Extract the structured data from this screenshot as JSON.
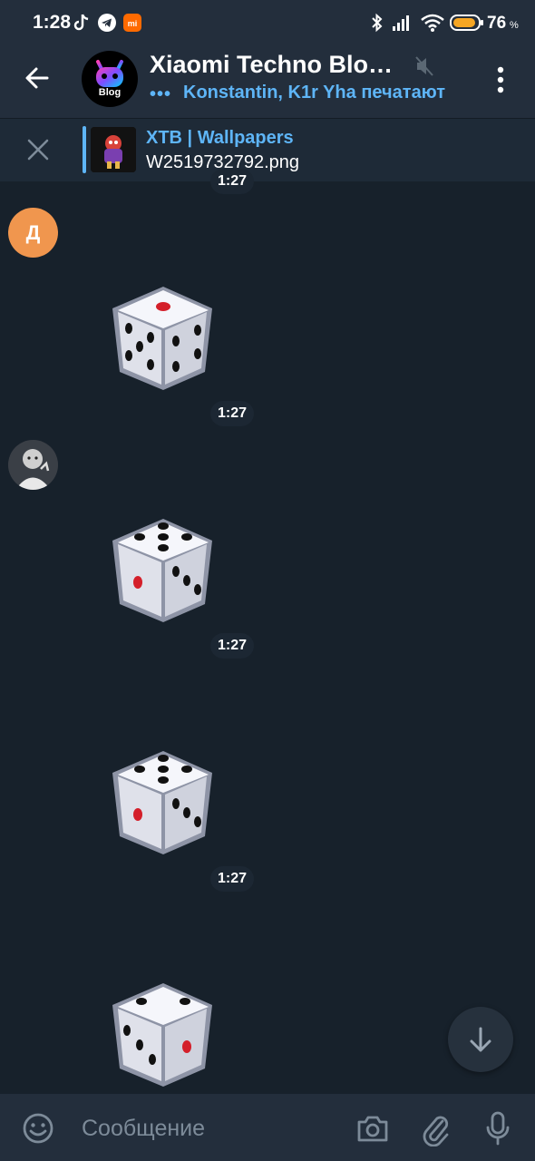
{
  "status_bar": {
    "time": "1:28",
    "battery_level": "76",
    "battery_pct_sign": "%"
  },
  "header": {
    "title": "Xiaomi Techno Blo…",
    "avatar_text": "Blog",
    "typing_dots": "•••",
    "status": "Konstantin, K1r Yha печатают"
  },
  "pinned": {
    "title": "XTB | Wallpapers",
    "text": "W2519732792.png"
  },
  "messages": [
    {
      "time": "1:27"
    },
    {
      "sender_initial": "Д",
      "dice_value": 1,
      "time": "1:27"
    },
    {
      "dice_value": 5,
      "time": "1:27"
    },
    {
      "dice_value": 5,
      "time": "1:27"
    },
    {
      "dice_value": 3
    }
  ],
  "input": {
    "placeholder": "Сообщение"
  },
  "colors": {
    "background": "#17212b",
    "header": "#232e3c",
    "accent": "#5eb5f7",
    "avatar_orange": "#f0964e"
  }
}
